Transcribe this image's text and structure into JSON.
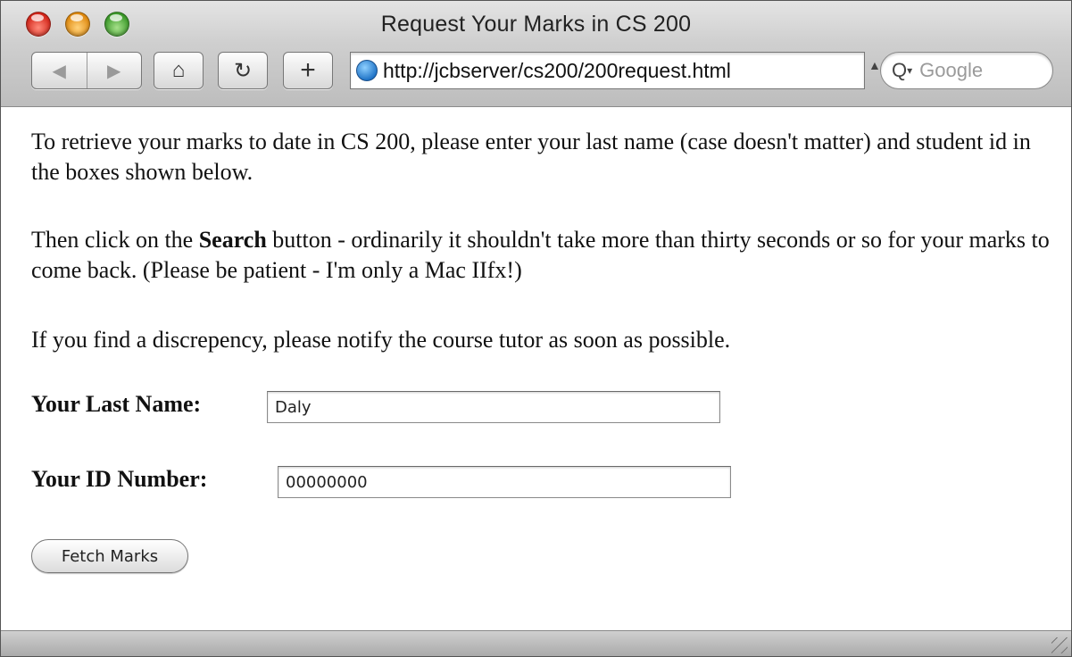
{
  "window": {
    "title": "Request Your Marks in CS 200"
  },
  "toolbar": {
    "back_glyph": "◀",
    "forward_glyph": "▶",
    "home_glyph": "⌂",
    "reload_glyph": "↻",
    "add_glyph": "+",
    "address": "http://jcbserver/cs200/200request.html",
    "address_arrow": "▲",
    "search_icon_glyph": "Q",
    "search_caret": "▾",
    "search_placeholder": "Google"
  },
  "page": {
    "para1": "To retrieve your marks to date in CS 200, please enter your last name (case doesn't matter) and student id in the boxes shown below.",
    "para2_before": "Then click on the ",
    "para2_bold": "Search",
    "para2_after": " button - ordinarily it shouldn't take more than thirty seconds or so for your marks to come back. (Please be patient - I'm only a Mac IIfx!)",
    "para3": "If you find a discrepency, please notify the course tutor as soon as possible.",
    "last_name_label": "Your Last Name:",
    "last_name_value": "Daly",
    "id_label": "Your ID Number:",
    "id_value": "00000000",
    "fetch_button": "Fetch Marks"
  },
  "icons": {
    "close": "close-icon",
    "minimize": "minimize-icon",
    "zoom": "zoom-icon",
    "globe": "globe-icon",
    "resize": "resize-grip-icon"
  },
  "colors": {
    "close": "#d4261a",
    "minimize": "#e08a10",
    "zoom": "#3c9a2a"
  }
}
